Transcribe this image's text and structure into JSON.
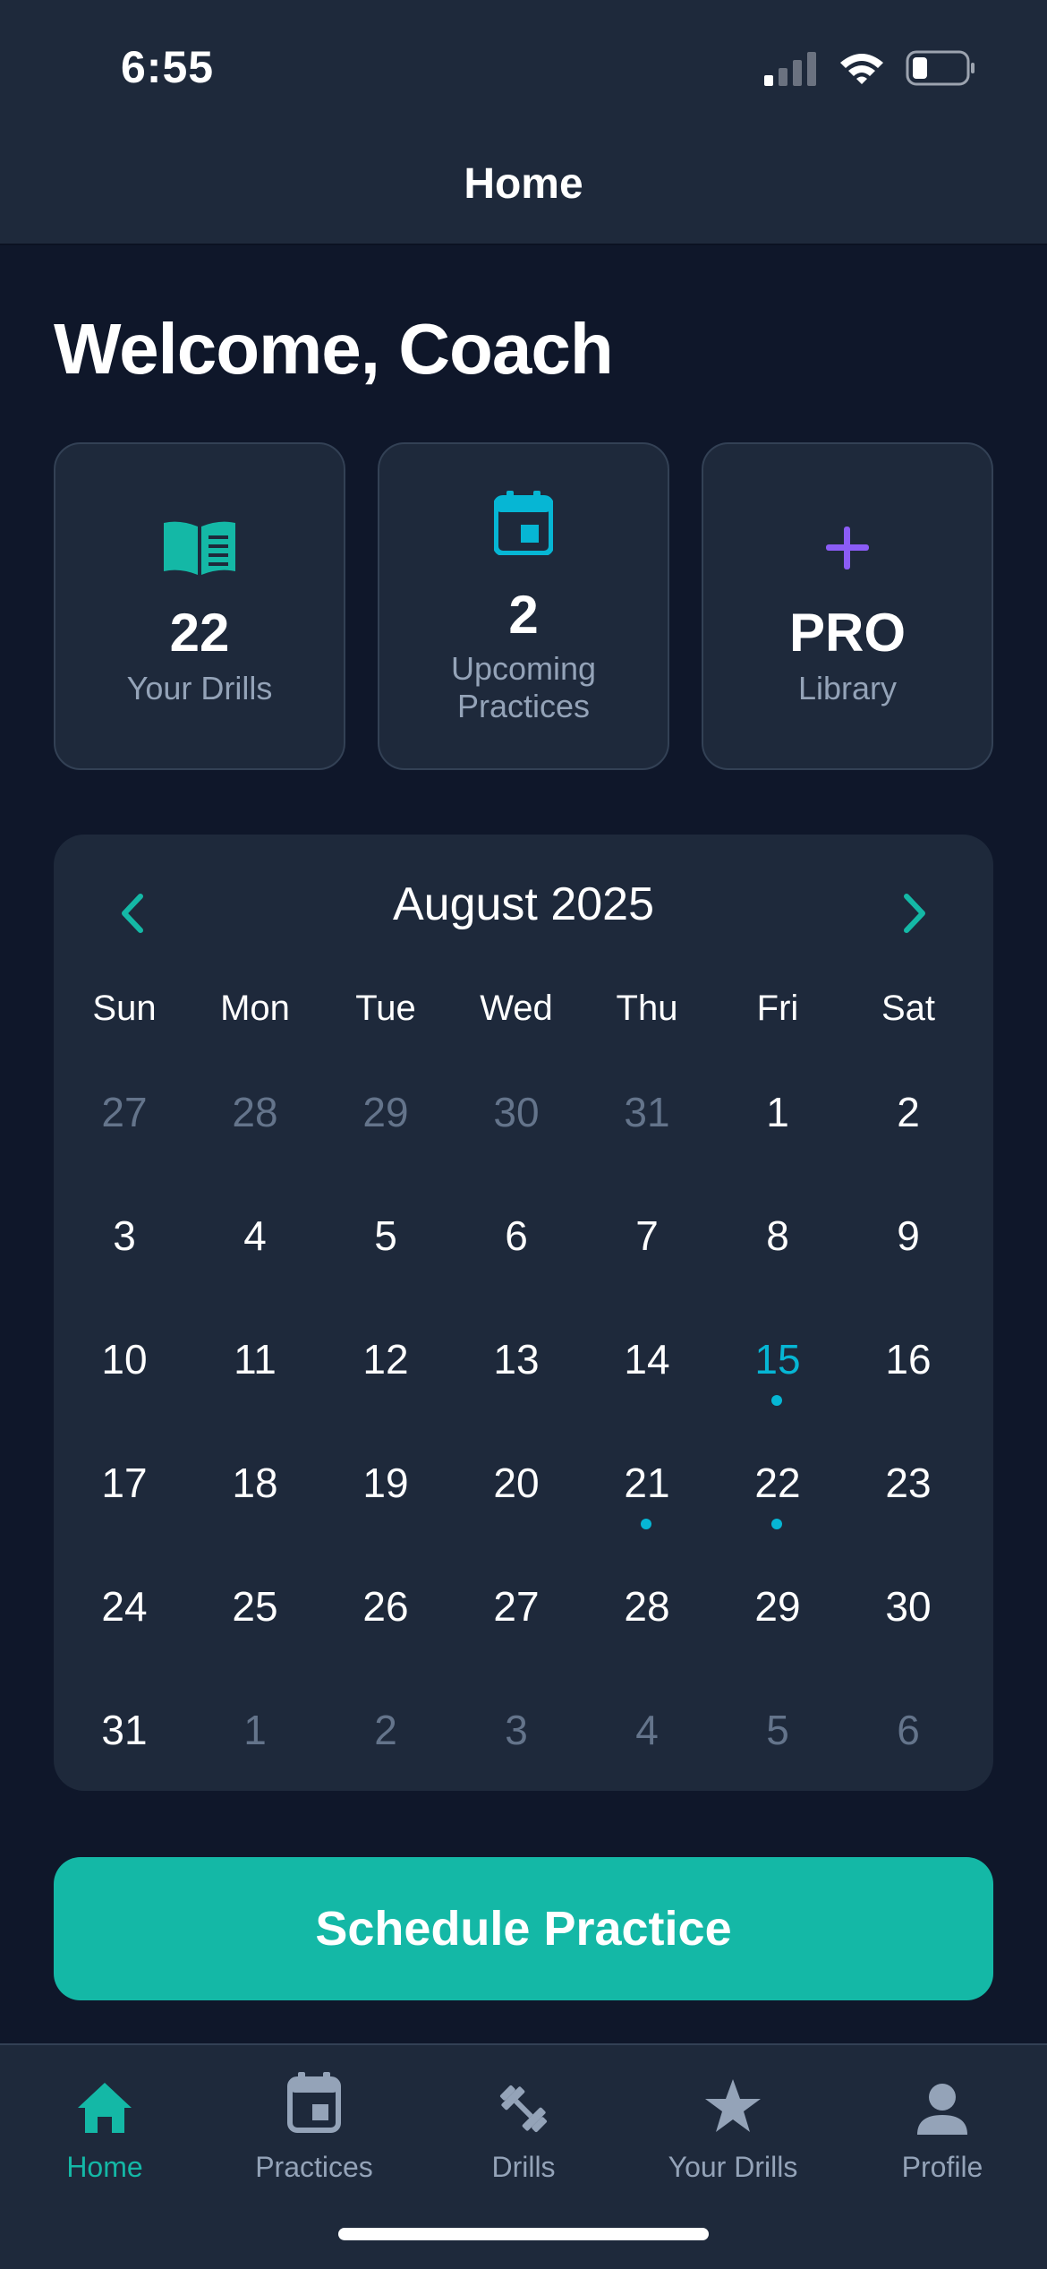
{
  "status_bar": {
    "time": "6:55"
  },
  "header": {
    "title": "Home"
  },
  "welcome": "Welcome, Coach",
  "stats": [
    {
      "icon": "book-open-icon",
      "value": "22",
      "label": "Your Drills"
    },
    {
      "icon": "calendar-icon",
      "value": "2",
      "label": "Upcoming Practices"
    },
    {
      "icon": "plus-icon",
      "value": "PRO",
      "label": "Library"
    }
  ],
  "calendar": {
    "month_label": "August 2025",
    "weekdays": [
      "Sun",
      "Mon",
      "Tue",
      "Wed",
      "Thu",
      "Fri",
      "Sat"
    ],
    "days": [
      {
        "n": "27",
        "muted": true
      },
      {
        "n": "28",
        "muted": true
      },
      {
        "n": "29",
        "muted": true
      },
      {
        "n": "30",
        "muted": true
      },
      {
        "n": "31",
        "muted": true
      },
      {
        "n": "1"
      },
      {
        "n": "2"
      },
      {
        "n": "3"
      },
      {
        "n": "4"
      },
      {
        "n": "5"
      },
      {
        "n": "6"
      },
      {
        "n": "7"
      },
      {
        "n": "8"
      },
      {
        "n": "9"
      },
      {
        "n": "10"
      },
      {
        "n": "11"
      },
      {
        "n": "12"
      },
      {
        "n": "13"
      },
      {
        "n": "14"
      },
      {
        "n": "15",
        "today": true,
        "event": true
      },
      {
        "n": "16"
      },
      {
        "n": "17"
      },
      {
        "n": "18"
      },
      {
        "n": "19"
      },
      {
        "n": "20"
      },
      {
        "n": "21",
        "event": true
      },
      {
        "n": "22",
        "event": true
      },
      {
        "n": "23"
      },
      {
        "n": "24"
      },
      {
        "n": "25"
      },
      {
        "n": "26"
      },
      {
        "n": "27"
      },
      {
        "n": "28"
      },
      {
        "n": "29"
      },
      {
        "n": "30"
      },
      {
        "n": "31"
      },
      {
        "n": "1",
        "muted": true
      },
      {
        "n": "2",
        "muted": true
      },
      {
        "n": "3",
        "muted": true
      },
      {
        "n": "4",
        "muted": true
      },
      {
        "n": "5",
        "muted": true
      },
      {
        "n": "6",
        "muted": true
      }
    ]
  },
  "schedule_button": "Schedule Practice",
  "tabs": [
    {
      "label": "Home",
      "icon": "home-icon",
      "active": true
    },
    {
      "label": "Practices",
      "icon": "calendar-icon",
      "active": false
    },
    {
      "label": "Drills",
      "icon": "dumbbell-icon",
      "active": false
    },
    {
      "label": "Your Drills",
      "icon": "star-icon",
      "active": false
    },
    {
      "label": "Profile",
      "icon": "person-icon",
      "active": false
    }
  ],
  "colors": {
    "background": "#0f172a",
    "surface": "#1e293b",
    "accent_teal": "#14b8a6",
    "accent_cyan": "#06b6d4",
    "accent_purple": "#8b5cf6",
    "muted_text": "#94a3b8",
    "inactive_tab": "#94a3b8"
  }
}
